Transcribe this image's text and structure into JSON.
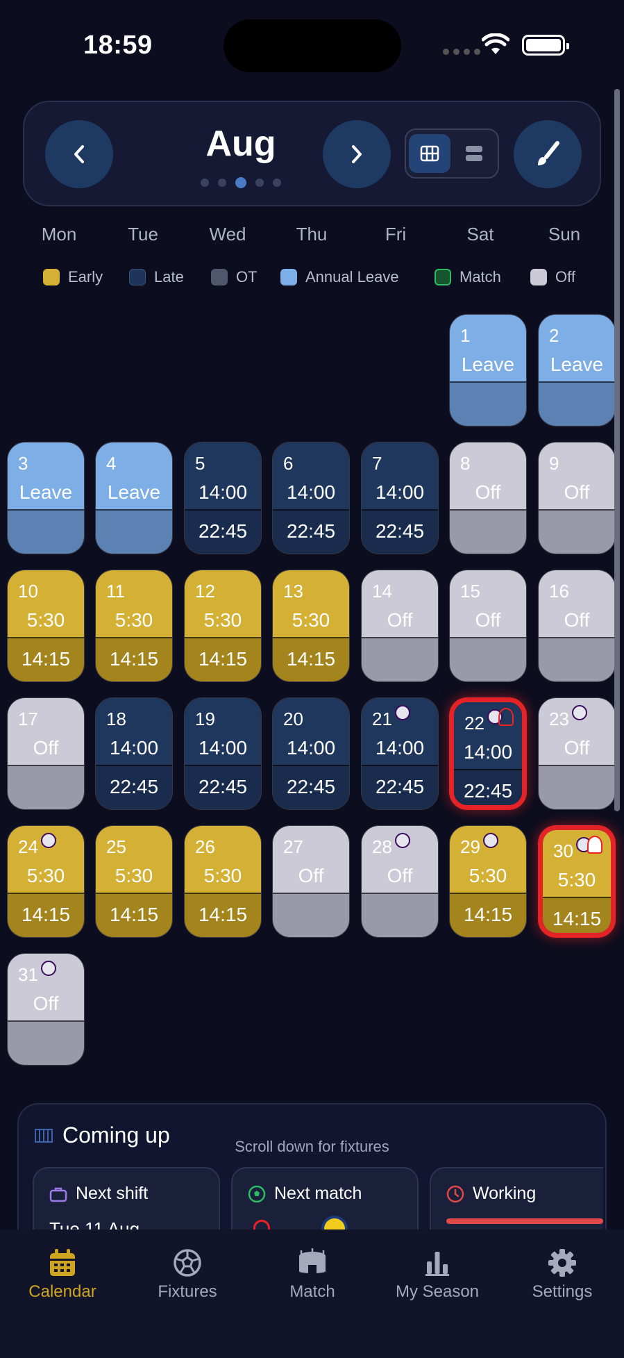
{
  "status": {
    "time": "18:59"
  },
  "header": {
    "month": "Aug"
  },
  "weekdays": [
    "Mon",
    "Tue",
    "Wed",
    "Thu",
    "Fri",
    "Sat",
    "Sun"
  ],
  "legend": [
    {
      "label": "Early",
      "color": "#d4b034"
    },
    {
      "label": "Late",
      "color": "#1e3459"
    },
    {
      "label": "OT",
      "color": "#50566c"
    },
    {
      "label": "Annual Leave",
      "color": "#7eaee6"
    },
    {
      "label": "Match",
      "color": "#16552e"
    },
    {
      "label": "Off",
      "color": "#cbcad6"
    }
  ],
  "calendar": [
    {
      "day": "1",
      "label": "Leave",
      "sub": "",
      "type": "leave"
    },
    {
      "day": "2",
      "label": "Leave",
      "sub": "",
      "type": "leave"
    },
    {
      "day": "3",
      "label": "Leave",
      "sub": "",
      "type": "leave"
    },
    {
      "day": "4",
      "label": "Leave",
      "sub": "",
      "type": "leave"
    },
    {
      "day": "5",
      "label": "14:00",
      "sub": "22:45",
      "type": "late"
    },
    {
      "day": "6",
      "label": "14:00",
      "sub": "22:45",
      "type": "late"
    },
    {
      "day": "7",
      "label": "14:00",
      "sub": "22:45",
      "type": "late"
    },
    {
      "day": "8",
      "label": "Off",
      "sub": "",
      "type": "off"
    },
    {
      "day": "9",
      "label": "Off",
      "sub": "",
      "type": "off"
    },
    {
      "day": "10",
      "label": "5:30",
      "sub": "14:15",
      "type": "early"
    },
    {
      "day": "11",
      "label": "5:30",
      "sub": "14:15",
      "type": "early"
    },
    {
      "day": "12",
      "label": "5:30",
      "sub": "14:15",
      "type": "early"
    },
    {
      "day": "13",
      "label": "5:30",
      "sub": "14:15",
      "type": "early"
    },
    {
      "day": "14",
      "label": "Off",
      "sub": "",
      "type": "off"
    },
    {
      "day": "15",
      "label": "Off",
      "sub": "",
      "type": "off"
    },
    {
      "day": "16",
      "label": "Off",
      "sub": "",
      "type": "off"
    },
    {
      "day": "17",
      "label": "Off",
      "sub": "",
      "type": "off"
    },
    {
      "day": "18",
      "label": "14:00",
      "sub": "22:45",
      "type": "late"
    },
    {
      "day": "19",
      "label": "14:00",
      "sub": "22:45",
      "type": "late"
    },
    {
      "day": "20",
      "label": "14:00",
      "sub": "22:45",
      "type": "late"
    },
    {
      "day": "21",
      "label": "14:00",
      "sub": "22:45",
      "type": "late",
      "league": true
    },
    {
      "day": "22",
      "label": "14:00",
      "sub": "22:45",
      "type": "late",
      "league": true,
      "match": true
    },
    {
      "day": "23",
      "label": "Off",
      "sub": "",
      "type": "off",
      "league": true
    },
    {
      "day": "24",
      "label": "5:30",
      "sub": "14:15",
      "type": "early",
      "league": true
    },
    {
      "day": "25",
      "label": "5:30",
      "sub": "14:15",
      "type": "early"
    },
    {
      "day": "26",
      "label": "5:30",
      "sub": "14:15",
      "type": "early"
    },
    {
      "day": "27",
      "label": "Off",
      "sub": "",
      "type": "off"
    },
    {
      "day": "28",
      "label": "Off",
      "sub": "",
      "type": "off",
      "league": true
    },
    {
      "day": "29",
      "label": "5:30",
      "sub": "14:15",
      "type": "early",
      "league": true
    },
    {
      "day": "30",
      "label": "5:30",
      "sub": "14:15",
      "type": "early",
      "league": true,
      "match": true
    },
    {
      "day": "31",
      "label": "Off",
      "sub": "",
      "type": "off",
      "league": true
    }
  ],
  "coming_up": {
    "title": "Coming up",
    "hint": "Scroll down for fixtures",
    "next_shift_label": "Next shift",
    "next_shift_value": "Tue 11 Aug",
    "next_match_label": "Next match",
    "working_label": "Working"
  },
  "nav": [
    {
      "label": "Calendar",
      "icon": "calendar-icon"
    },
    {
      "label": "Fixtures",
      "icon": "football-icon"
    },
    {
      "label": "Match",
      "icon": "stadium-icon"
    },
    {
      "label": "My Season",
      "icon": "bar-chart-icon"
    },
    {
      "label": "Settings",
      "icon": "gear-icon"
    }
  ]
}
